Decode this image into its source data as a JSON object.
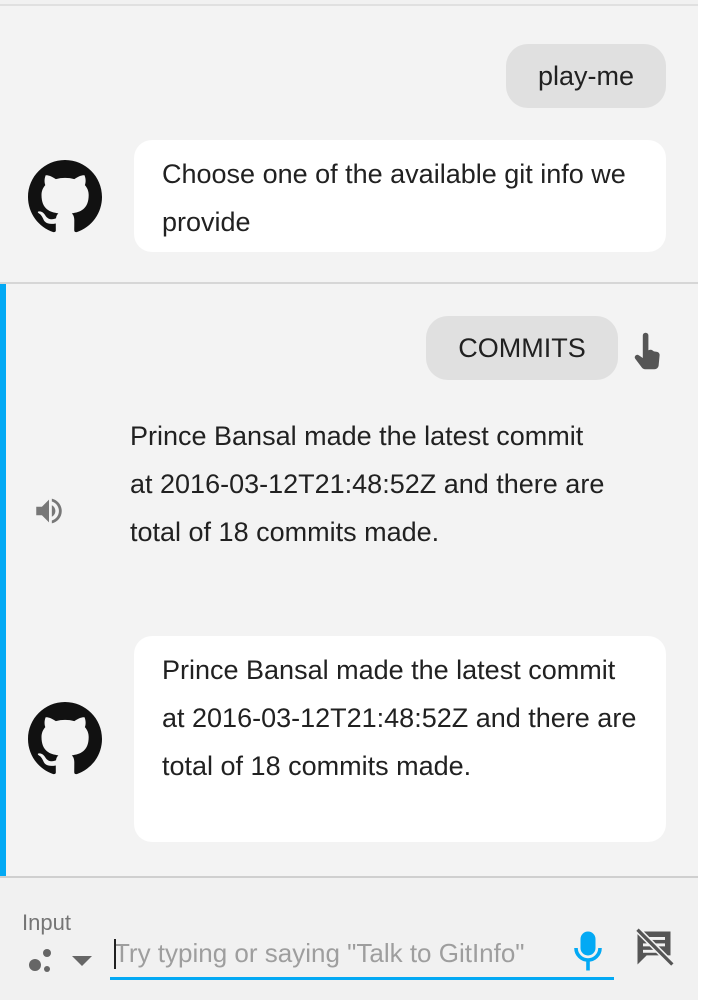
{
  "conversation": {
    "turn1": {
      "user_query": "play-me",
      "bot_response": "Choose one of the available git info we provide"
    },
    "turn2": {
      "user_query": "COMMITS",
      "tts_text": "Prince Bansal made the latest commit at 2016-03-12T21:48:52Z and there are total of 18 commits made.",
      "bot_response": "Prince Bansal made the latest commit at 2016-03-12T21:48:52Z and there are total of 18 commits made."
    }
  },
  "input_bar": {
    "label": "Input",
    "placeholder": "Try typing or saying \"Talk to GitInfo\"",
    "value": ""
  },
  "icons": {
    "avatar": "github-icon",
    "speaker": "speaker-icon",
    "touch": "touch-icon",
    "mode": "assistant-dots-icon",
    "dropdown": "chevron-down-icon",
    "mic": "mic-icon",
    "no_transcript": "no-transcript-icon"
  },
  "colors": {
    "accent": "#03a9f4",
    "user_chip": "#e0e0e0",
    "bubble": "#ffffff",
    "background": "#f3f3f3"
  }
}
